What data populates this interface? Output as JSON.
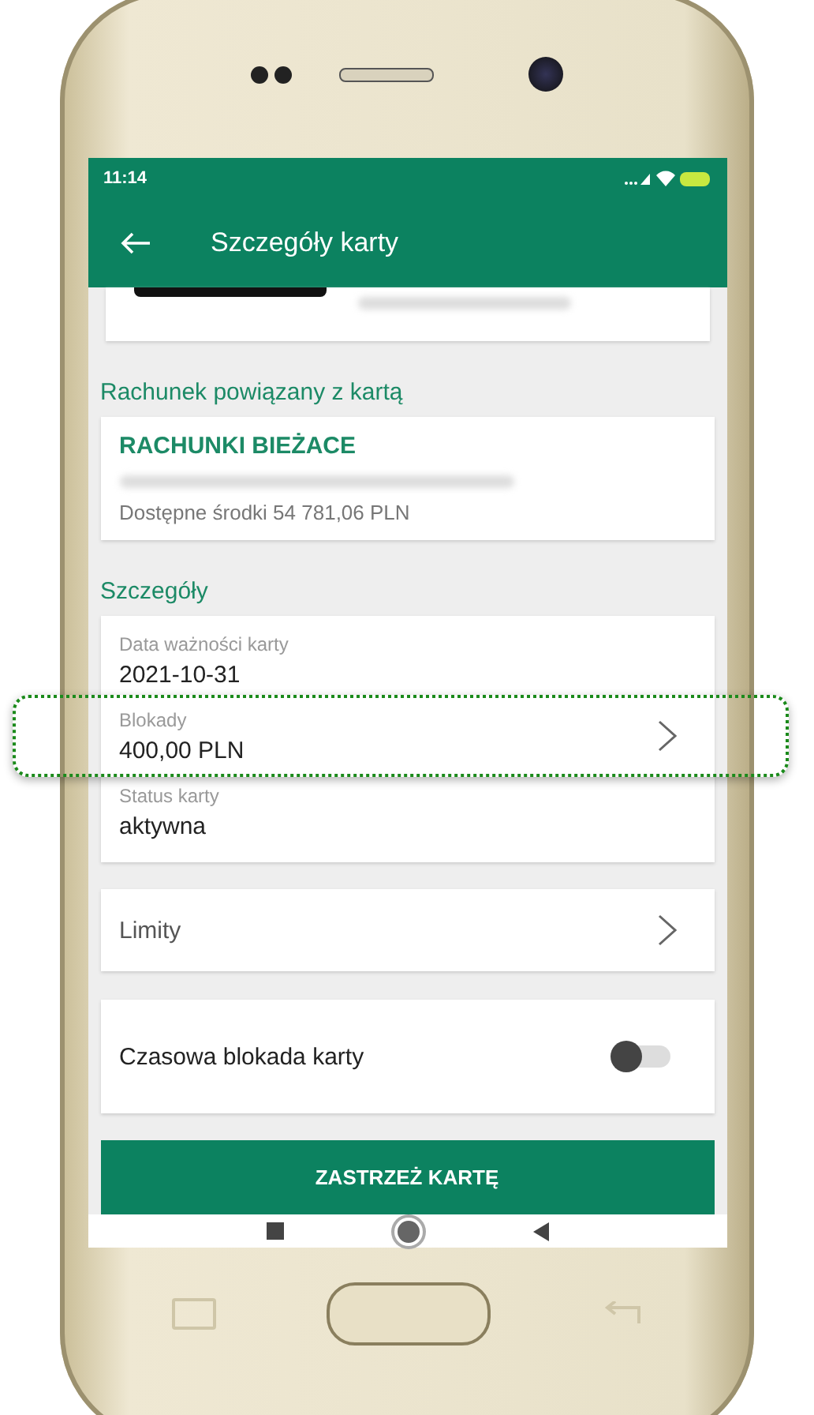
{
  "status_bar": {
    "time": "11:14"
  },
  "app_bar": {
    "title": "Szczegóły karty"
  },
  "account_section": {
    "heading": "Rachunek powiązany z kartą",
    "account_name": "RACHUNKI BIEŻACE",
    "available_funds": "Dostępne środki 54 781,06 PLN"
  },
  "details_section": {
    "heading": "Szczegóły",
    "items": [
      {
        "kind": "plain",
        "label": "Data ważności karty",
        "value": "2021-10-31",
        "highlighted": false
      },
      {
        "kind": "link",
        "label": "Blokady",
        "value": "400,00 PLN",
        "highlighted": true
      },
      {
        "kind": "plain",
        "label": "Status karty",
        "value": "aktywna",
        "highlighted": false
      }
    ]
  },
  "limits_row": {
    "label": "Limity"
  },
  "temporary_block": {
    "label": "Czasowa blokada karty",
    "on": false
  },
  "block_button": {
    "label": "ZASTRZEŻ KARTĘ"
  }
}
